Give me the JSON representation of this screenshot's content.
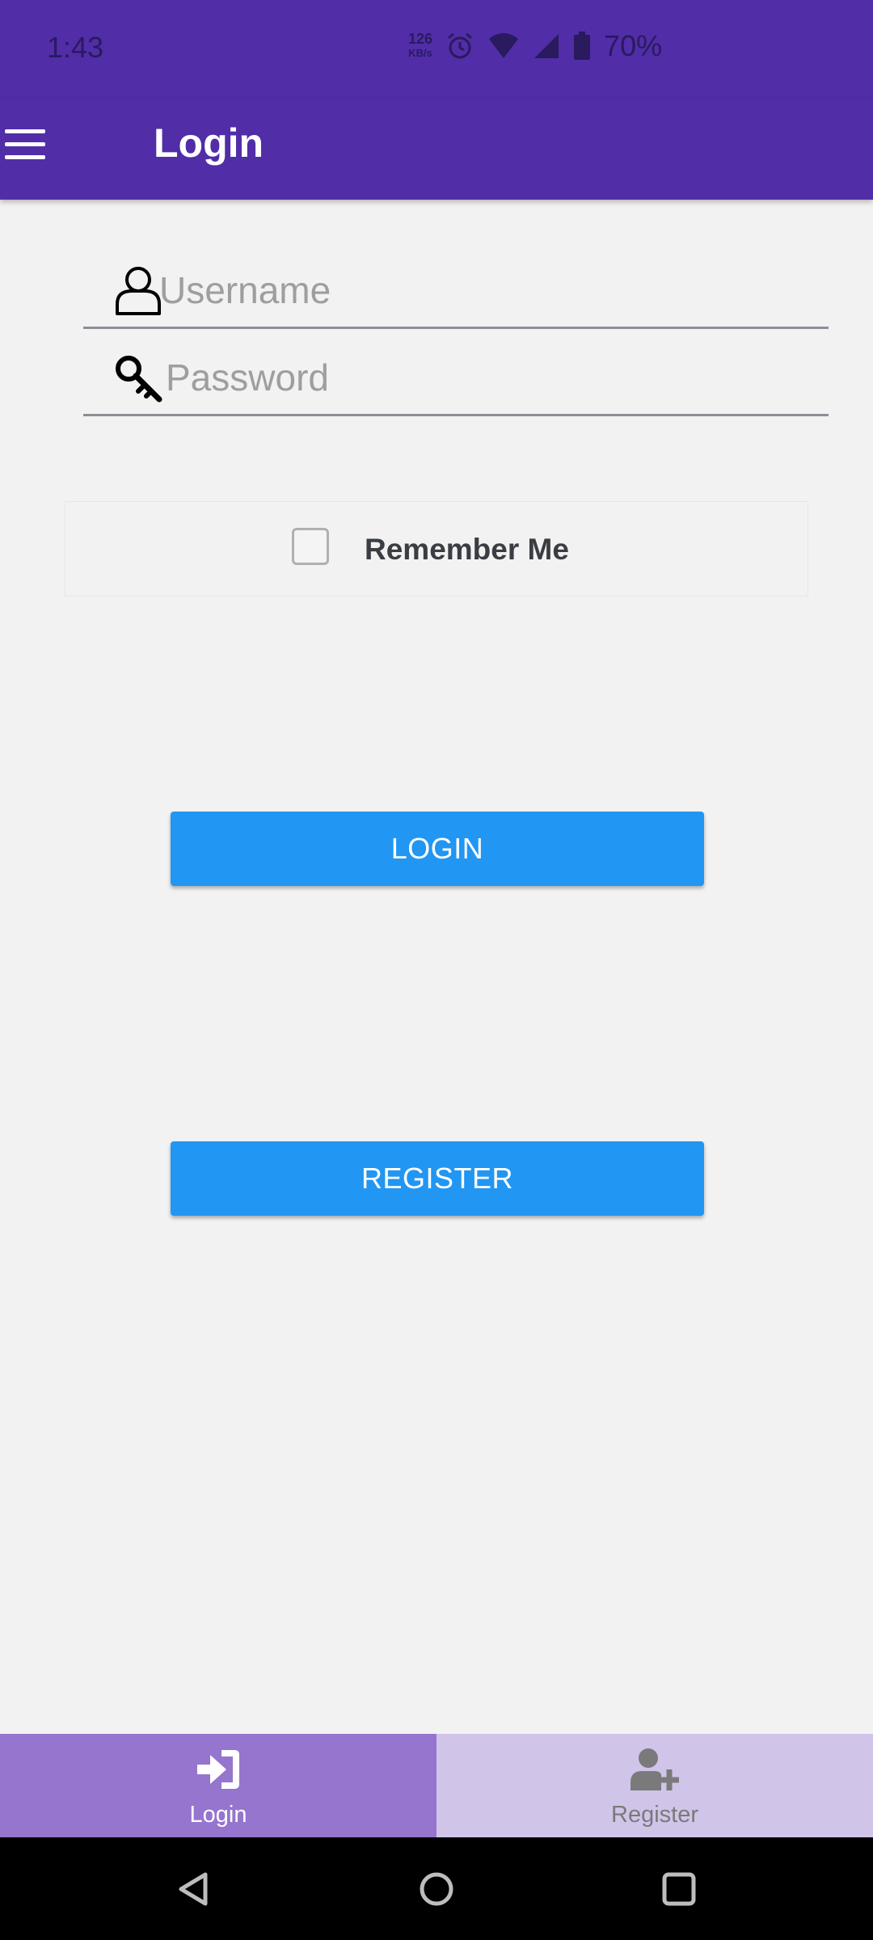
{
  "status_bar": {
    "time": "1:43",
    "speed_value": "126",
    "speed_unit": "KB/s",
    "battery_percent": "70%",
    "icons": [
      "alarm-icon",
      "wifi-icon",
      "signal-icon",
      "battery-icon"
    ]
  },
  "app_bar": {
    "title": "Login",
    "menu_icon": "hamburger-menu-icon",
    "background": "#512da8"
  },
  "form": {
    "username": {
      "placeholder": "Username",
      "value": "",
      "icon": "user-icon"
    },
    "password": {
      "placeholder": "Password",
      "value": "",
      "icon": "key-icon"
    },
    "remember_me": {
      "label": "Remember Me",
      "checked": false
    }
  },
  "buttons": {
    "login": "LOGIN",
    "register": "REGISTER",
    "color": "#2196f3"
  },
  "bottom_nav": {
    "tabs": [
      {
        "label": "Login",
        "icon": "sign-in-icon",
        "active": true
      },
      {
        "label": "Register",
        "icon": "user-plus-icon",
        "active": false
      }
    ]
  },
  "system_nav": [
    "back-icon",
    "home-icon",
    "recents-icon"
  ]
}
